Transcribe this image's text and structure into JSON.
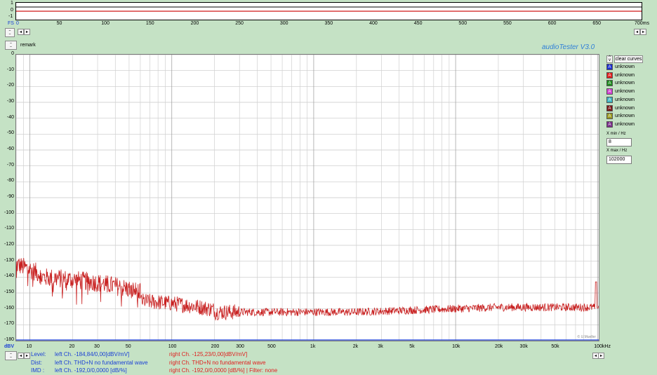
{
  "scope": {
    "y_labels": [
      "1",
      "0",
      "-1"
    ],
    "fs_label": "FS",
    "x_labels": [
      "0",
      "50",
      "100",
      "150",
      "200",
      "250",
      "300",
      "350",
      "400",
      "450",
      "500",
      "550",
      "600",
      "650",
      "700ms"
    ]
  },
  "remark_label": "remark",
  "brand": "audioTester  V3.0",
  "spectrum": {
    "y_labels": [
      "0",
      "-10",
      "-20",
      "-30",
      "-40",
      "-50",
      "-60",
      "-70",
      "-80",
      "-90",
      "-100",
      "-110",
      "-120",
      "-130",
      "-140",
      "-150",
      "-160",
      "-170",
      "-180"
    ],
    "y_unit": "dBV",
    "x_labels": [
      "10",
      "20",
      "30",
      "50",
      "100",
      "200",
      "300",
      "500",
      "1k",
      "2k",
      "3k",
      "5k",
      "10k",
      "20k",
      "30k",
      "50k",
      "100kHz"
    ],
    "watermark": "© U.Mueller"
  },
  "legend": {
    "clear_label": "clear curves",
    "items": [
      {
        "label": "unknown",
        "color": "#1c2fd0",
        "glyph": "A"
      },
      {
        "label": "unknown",
        "color": "#e01e1e",
        "glyph": "A"
      },
      {
        "label": "unknown",
        "color": "#1d8a1d",
        "glyph": "A"
      },
      {
        "label": "unknown",
        "color": "#d040d0",
        "glyph": "A"
      },
      {
        "label": "unknown",
        "color": "#3ab3c0",
        "glyph": "A"
      },
      {
        "label": "unknown",
        "color": "#7a1818",
        "glyph": "A"
      },
      {
        "label": "unknown",
        "color": "#9a9a20",
        "glyph": "A"
      },
      {
        "label": "unknown",
        "color": "#7a2d8a",
        "glyph": "A"
      }
    ],
    "xmin_label": "X min / Hz",
    "xmin_value": "8",
    "xmax_label": "X max / Hz",
    "xmax_value": "102000"
  },
  "status": {
    "level_label": "Level:",
    "level_left": "left Ch. -184,84/0,00[dBV/mV]",
    "level_right": "right Ch. -125,23/0,00[dBV/mV]",
    "dist_label": "Dist:",
    "dist_left": "left Ch. THD+N  no fundamental wave",
    "dist_right": "right Ch. THD+N  no fundamental wave",
    "imd_label": "IMD  :",
    "imd_left": "left Ch. -192,0/0,0000 [dB/%]",
    "imd_right": "right Ch. -192,0/0,0000 [dB/%] |   Filter: none"
  },
  "colors": {
    "background": "#c5e2c5",
    "left_channel": "#1a3fd6",
    "right_channel": "#c82020",
    "brand": "#2f7fd8"
  }
}
